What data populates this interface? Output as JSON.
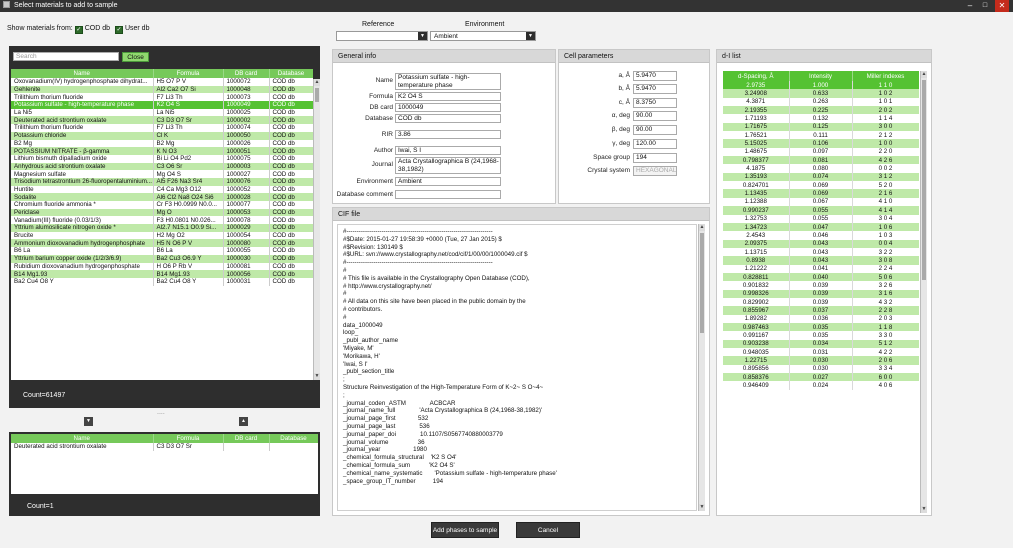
{
  "window": {
    "title": "Select materials to add to sample",
    "min": "–",
    "max": "□",
    "close": "✕"
  },
  "filter": {
    "label": "Show materials from:",
    "cod": "COD db",
    "user": "User db"
  },
  "search": {
    "placeholder": "Search",
    "close": "Close"
  },
  "columns": [
    "Name",
    "Formula",
    "DB card",
    "Database"
  ],
  "materials": [
    [
      "Oxovanadium(IV) hydrogenphosphate dihydrat...",
      "H5 O7 P V",
      "1000072",
      "COD db"
    ],
    [
      "Gehlenite",
      "Al2 Ca2 O7 Si",
      "1000048",
      "COD db"
    ],
    [
      "Trilithium thorium fluoride",
      "F7 Li3 Th",
      "1000073",
      "COD db"
    ],
    [
      "Potassium sulfate - high-temperature phase",
      "K2 O4 S",
      "1000049",
      "COD db"
    ],
    [
      "La Ni5",
      "La Ni5",
      "1000025",
      "COD db"
    ],
    [
      "Deuterated acid strontium oxalate",
      "C3 D3 O7 Sr",
      "1000002",
      "COD db"
    ],
    [
      "Trilithium thorium fluoride",
      "F7 Li3 Th",
      "1000074",
      "COD db"
    ],
    [
      "Potassium chloride",
      "Cl K",
      "1000050",
      "COD db"
    ],
    [
      "B2 Mg",
      "B2 Mg",
      "1000026",
      "COD db"
    ],
    [
      "POTASSIUM NITRATE - β-gamma",
      "K N O3",
      "1000051",
      "COD db"
    ],
    [
      "Lithium bismuth dipalladium oxide",
      "Bi Li O4 Pd2",
      "1000075",
      "COD db"
    ],
    [
      "Anhydrous acid strontium oxalate",
      "C3 O6 Sr",
      "1000003",
      "COD db"
    ],
    [
      "Magnesium sulfate",
      "Mg O4 S",
      "1000027",
      "COD db"
    ],
    [
      "Trisodium tetrastrontium 26-fluoropentaluminium...",
      "Al5 F26 Na3 Sr4",
      "1000076",
      "COD db"
    ],
    [
      "Huntite",
      "C4 Ca Mg3 O12",
      "1000052",
      "COD db"
    ],
    [
      "Sodalite",
      "Al6 Cl2 Na8 O24 Si6",
      "1000028",
      "COD db"
    ],
    [
      "Chromium fluoride ammonia *",
      "Cr F3 H0.0999 N0.0...",
      "1000077",
      "COD db"
    ],
    [
      "Periclase",
      "Mg O",
      "1000053",
      "COD db"
    ],
    [
      "Vanadium(III) fluoride (0.03/1/3)",
      "F3 H0.0801 N0.026...",
      "1000078",
      "COD db"
    ],
    [
      "Yttrium alumosilicate nitrogen oxide *",
      "Al2.7 N15.1 O0.9 Si...",
      "1000029",
      "COD db"
    ],
    [
      "Brucite",
      "H2 Mg O2",
      "1000054",
      "COD db"
    ],
    [
      "Ammonium dioxovanadium hydrogenphosphate",
      "H5 N O6 P V",
      "1000080",
      "COD db"
    ],
    [
      "B6 La",
      "B6 La",
      "1000055",
      "COD db"
    ],
    [
      "Yttrium barium copper oxide (1/2/3/6.9)",
      "Ba2 Cu3 O6.9 Y",
      "1000030",
      "COD db"
    ],
    [
      "Rubidium dioxovanadium hydrogenphosphate",
      "H O6 P Rb V",
      "1000081",
      "COD db"
    ],
    [
      "B14 Mg1.93",
      "B14 Mg1.93",
      "1000056",
      "COD db"
    ],
    [
      "Ba2 Cu4 O8 Y",
      "Ba2 Cu4 O8 Y",
      "1000031",
      "COD db"
    ]
  ],
  "count_top": "Count=61497",
  "splitter": "....",
  "selected": [
    [
      "Deuterated acid strontium oxalate",
      "C3 D3 O7 Sr",
      "",
      ""
    ]
  ],
  "count_bottom": "Count=1",
  "reference": {
    "label": "Reference",
    "value": ""
  },
  "environment": {
    "label": "Environment",
    "value": "Ambient"
  },
  "general": {
    "title": "General info",
    "fields": [
      {
        "label": "Name",
        "value": "Potassium sulfate - high-temperature phase"
      },
      {
        "label": "Formula",
        "value": "K2 O4 S"
      },
      {
        "label": "DB card",
        "value": "1000049"
      },
      {
        "label": "Database",
        "value": "COD db"
      },
      {
        "label": "RIR",
        "value": "3.86"
      },
      {
        "label": "Author",
        "value": "Iwai, S I"
      },
      {
        "label": "Journal",
        "value": "Acta Crystallographica B (24,1968-38,1982)"
      },
      {
        "label": "Environment",
        "value": "Ambient"
      },
      {
        "label": "Database comment",
        "value": ""
      }
    ]
  },
  "cell": {
    "title": "Cell parameters",
    "fields": [
      {
        "label": "a, Å",
        "value": "5.9470"
      },
      {
        "label": "b, Å",
        "value": "5.9470"
      },
      {
        "label": "c, Å",
        "value": "8.3750"
      },
      {
        "label": "α, deg",
        "value": "90.00"
      },
      {
        "label": "β, deg",
        "value": "90.00"
      },
      {
        "label": "γ, deg",
        "value": "120.00"
      },
      {
        "label": "Space group",
        "value": "194"
      },
      {
        "label": "Crystal system",
        "value": "HEXAGONAL"
      }
    ]
  },
  "cif": {
    "title": "CIF file",
    "lines": [
      "#-----------------------------------------------------------------------",
      "#$Date: 2015-01-27 19:58:39 +0000 (Tue, 27 Jan 2015) $",
      "#$Revision: 130149 $",
      "#$URL: svn://www.crystallography.net/cod/cif/1/00/00/1000049.cif $",
      "#-----------------------------------------------------------------------",
      "#",
      "# This file is available in the Crystallography Open Database (COD),",
      "# http://www.crystallography.net/",
      "#",
      "# All data on this site have been placed in the public domain by the",
      "# contributors.",
      "#",
      "data_1000049",
      "loop_",
      "_publ_author_name",
      "'Miyake, M'",
      "'Morikawa, H'",
      "'Iwai, S I'",
      "_publ_section_title",
      ";",
      "Structure Reinvestigation of the High-Temperature Form of K~2~ S O~4~",
      ";",
      "_journal_coden_ASTM              ACBCAR",
      "_journal_name_full              'Acta Crystallographica B (24,1968-38,1982)'",
      "_journal_page_first             532",
      "_journal_page_last              536",
      "_journal_paper_doi              10.1107/S0567740880003779",
      "_journal_volume                 36",
      "_journal_year                   1980",
      "_chemical_formula_structural    'K2 S O4'",
      "_chemical_formula_sum           'K2 O4 S'",
      "_chemical_name_systematic       'Potassium sulfate - high-temperature phase'",
      "_space_group_IT_number          194"
    ]
  },
  "dlist": {
    "title": "d-I list",
    "columns": [
      "d-Spacing, Å",
      "Intensity",
      "Miller indexes"
    ],
    "rows": [
      [
        "2.9735",
        "1.000",
        "1 1 0"
      ],
      [
        "3.24908",
        "0.633",
        "1 0 2"
      ],
      [
        "4.3871",
        "0.263",
        "1 0 1"
      ],
      [
        "2.19355",
        "0.225",
        "2 0 2"
      ],
      [
        "1.71193",
        "0.132",
        "1 1 4"
      ],
      [
        "1.71675",
        "0.125",
        "3 0 0"
      ],
      [
        "1.76521",
        "0.111",
        "2 1 2"
      ],
      [
        "5.15025",
        "0.106",
        "1 0 0"
      ],
      [
        "1.48675",
        "0.097",
        "2 2 0"
      ],
      [
        "0.798377",
        "0.081",
        "4 2 6"
      ],
      [
        "4.1875",
        "0.080",
        "0 0 2"
      ],
      [
        "1.35193",
        "0.074",
        "3 1 2"
      ],
      [
        "0.824701",
        "0.069",
        "5 2 0"
      ],
      [
        "1.13435",
        "0.069",
        "2 1 6"
      ],
      [
        "1.12388",
        "0.067",
        "4 1 0"
      ],
      [
        "0.990237",
        "0.055",
        "4 1 4"
      ],
      [
        "1.32753",
        "0.055",
        "3 0 4"
      ],
      [
        "1.34723",
        "0.047",
        "1 0 6"
      ],
      [
        "2.4543",
        "0.046",
        "1 0 3"
      ],
      [
        "2.09375",
        "0.043",
        "0 0 4"
      ],
      [
        "1.13715",
        "0.043",
        "3 2 2"
      ],
      [
        "0.8938",
        "0.043",
        "3 0 8"
      ],
      [
        "1.21222",
        "0.041",
        "2 2 4"
      ],
      [
        "0.828811",
        "0.040",
        "5 0 6"
      ],
      [
        "0.901832",
        "0.039",
        "3 2 6"
      ],
      [
        "0.998326",
        "0.039",
        "3 1 6"
      ],
      [
        "0.829902",
        "0.039",
        "4 3 2"
      ],
      [
        "0.855967",
        "0.037",
        "2 2 8"
      ],
      [
        "1.89282",
        "0.036",
        "2 0 3"
      ],
      [
        "0.987463",
        "0.035",
        "1 1 8"
      ],
      [
        "0.991167",
        "0.035",
        "3 3 0"
      ],
      [
        "0.903238",
        "0.034",
        "5 1 2"
      ],
      [
        "0.948035",
        "0.031",
        "4 2 2"
      ],
      [
        "1.22715",
        "0.030",
        "2 0 6"
      ],
      [
        "0.895856",
        "0.030",
        "3 3 4"
      ],
      [
        "0.858376",
        "0.027",
        "6 0 0"
      ],
      [
        "0.946409",
        "0.024",
        "4 0 6"
      ]
    ]
  },
  "buttons": {
    "add": "Add phases to sample",
    "cancel": "Cancel"
  }
}
